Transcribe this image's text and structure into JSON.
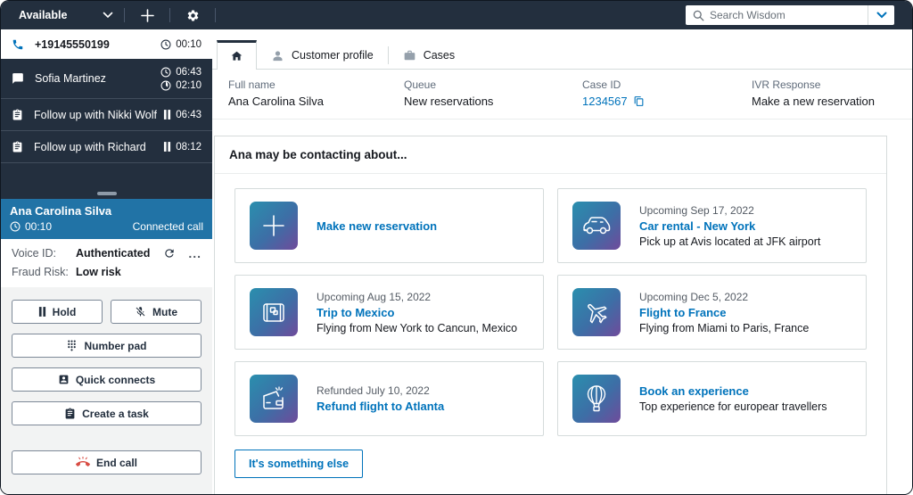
{
  "topbar": {
    "status": "Available",
    "search_placeholder": "Search Wisdom"
  },
  "contacts": [
    {
      "name": "+19145550199",
      "type": "voice",
      "time1": "00:10",
      "active": true
    },
    {
      "name": "Sofia Martinez",
      "type": "chat",
      "time1": "06:43",
      "time2": "02:10"
    },
    {
      "name": "Follow up with Nikki Wolf",
      "type": "task",
      "time1": "06:43"
    },
    {
      "name": "Follow up with Richard",
      "type": "task",
      "time1": "08:12"
    }
  ],
  "call_panel": {
    "customer_name": "Ana Carolina Silva",
    "duration": "00:10",
    "status": "Connected call",
    "voice_id_label": "Voice ID:",
    "voice_id_value": "Authenticated",
    "fraud_risk_label": "Fraud Risk:",
    "fraud_risk_value": "Low risk",
    "ellipsis": "..."
  },
  "controls": {
    "hold": "Hold",
    "mute": "Mute",
    "number_pad": "Number pad",
    "quick_connects": "Quick connects",
    "create_task": "Create a task",
    "end_call": "End call"
  },
  "tabs": {
    "customer_profile": "Customer profile",
    "cases": "Cases"
  },
  "contact_info": {
    "fields": [
      {
        "label": "Full name",
        "value": "Ana Carolina Silva"
      },
      {
        "label": "Queue",
        "value": "New reservations"
      },
      {
        "label": "Case ID",
        "value": "1234567"
      },
      {
        "label": "IVR Response",
        "value": "Make a new reservation"
      }
    ]
  },
  "suggestions": {
    "title": "Ana may be contacting about...",
    "cards": [
      {
        "icon": "plus-icon",
        "subtitle": "",
        "title": "Make new reservation",
        "description": ""
      },
      {
        "icon": "car-icon",
        "subtitle": "Upcoming Sep 17, 2022",
        "title": "Car rental - New York",
        "description": "Pick up at Avis located at JFK airport"
      },
      {
        "icon": "suitcase-icon",
        "subtitle": "Upcoming Aug 15, 2022",
        "title": "Trip to Mexico",
        "description": "Flying from New York to Cancun, Mexico"
      },
      {
        "icon": "plane-icon",
        "subtitle": "Upcoming Dec 5, 2022",
        "title": "Flight to France",
        "description": "Flying from Miami to Paris, France"
      },
      {
        "icon": "wallet-icon",
        "subtitle": "Refunded July 10, 2022",
        "title": "Refund flight to Atlanta",
        "description": ""
      },
      {
        "icon": "balloon-icon",
        "subtitle": "",
        "title": "Book an experience",
        "description": "Top experience for europear travellers"
      }
    ],
    "something_else": "It's something else"
  },
  "colors": {
    "topbar_bg": "#232f3e",
    "connected_header_bg": "#2173a6",
    "link_blue": "#0073bb",
    "end_call_red": "#d84c43",
    "tile_gradient_start": "#2a8fae",
    "tile_gradient_end": "#6f4b9b"
  }
}
